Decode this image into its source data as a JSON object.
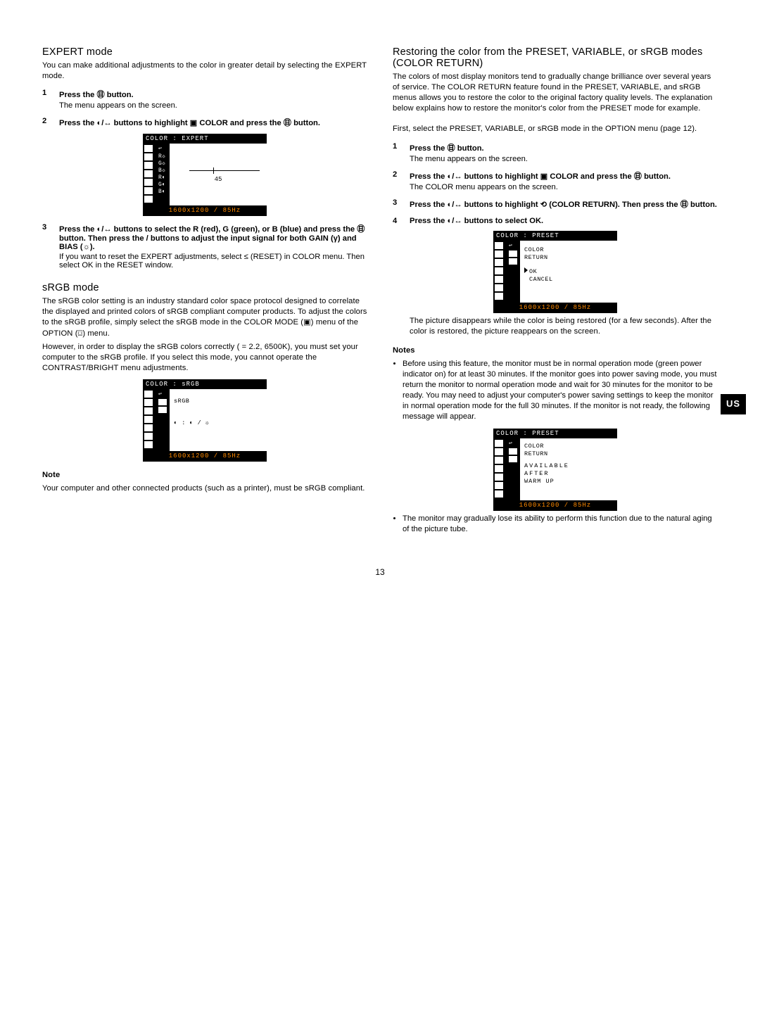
{
  "page_number": "13",
  "side_tab": "US",
  "left": {
    "expert": {
      "title": "EXPERT mode",
      "intro": "You can make additional adjustments to the color in greater detail by selecting the EXPERT mode.",
      "steps": [
        {
          "n": "1",
          "bold": "Press the ㊐ button.",
          "sub": "The menu appears on the screen."
        },
        {
          "n": "2",
          "bold": "Press the ◐/↔ buttons to highlight ▣ COLOR and press the ㊐ button.",
          "sub": ""
        },
        {
          "n": "3",
          "bold": "Press the ◐/↔ buttons to select the R (red), G (green), or B (blue) and press the ㊐ button. Then press the   /   buttons to adjust the input signal for both GAIN (γ) and BIAS (☼).",
          "sub": "If you want to reset the EXPERT adjustments, select ≤  (RESET) in COLOR menu. Then select OK in the RESET window."
        }
      ],
      "osd": {
        "title": "COLOR   : EXPERT",
        "labels": "R☼\nG☼\nB☼\nR◐\nG◐\nB◐",
        "slider_value": "45",
        "footer": "1600x1200 / 85Hz"
      }
    },
    "srgb": {
      "title": "sRGB mode",
      "p1": "The sRGB color setting is an industry standard color space protocol designed to correlate the displayed and printed colors of sRGB compliant computer products. To adjust the colors to the sRGB profile, simply select the sRGB mode in the COLOR MODE (▣) menu of the OPTION (⌼) menu.",
      "p2": "However, in order to display the sRGB colors correctly (  = 2.2, 6500K), you must set your computer to the sRGB profile. If you select this mode, you cannot operate the CONTRAST/BRIGHT menu adjustments.",
      "osd": {
        "title": "COLOR   : sRGB",
        "text_line": "sRGB",
        "bottom_row": "◐ : ◐ / ☼",
        "footer": "1600x1200 / 85Hz"
      },
      "note_head": "Note",
      "note_body": "Your computer and other connected products (such as a printer), must be sRGB compliant."
    }
  },
  "right": {
    "restore": {
      "title": "Restoring the color from the PRESET, VARIABLE, or sRGB modes (COLOR RETURN)",
      "intro": "The colors of most display monitors tend to gradually change brilliance over several years of service. The COLOR RETURN feature found in the PRESET, VARIABLE, and sRGB menus allows you to restore the color to the original factory quality levels. The explanation below explains how to restore the monitor's color from the PRESET mode for example.",
      "pre_step": "First, select the PRESET, VARIABLE, or sRGB mode in the OPTION menu (page 12).",
      "steps": [
        {
          "n": "1",
          "bold": "Press the ㊐ button.",
          "sub": "The menu appears on the screen."
        },
        {
          "n": "2",
          "bold": "Press the ◐/↔ buttons to highlight ▣ COLOR and press the ㊐ button.",
          "sub": "The COLOR menu appears on the screen."
        },
        {
          "n": "3",
          "bold": " Press the ◐/↔ buttons to highlight ⟲ (COLOR RETURN). Then press the ㊐ button.",
          "sub": ""
        },
        {
          "n": "4",
          "bold": "Press the ◐/↔ buttons to select OK.",
          "sub": ""
        }
      ],
      "osd1": {
        "title": "COLOR   : PRESET",
        "line1": "COLOR",
        "line2": "RETURN",
        "opt1": "OK",
        "opt2": "CANCEL",
        "footer": "1600x1200 / 85Hz"
      },
      "below_osd1": "The picture disappears while the color is being restored (for a few seconds). After the color is restored, the picture reappears on the screen.",
      "notes_head": "Notes",
      "notes": [
        "Before using this feature, the monitor must be in normal operation mode (green power indicator on) for at least 30 minutes. If the monitor goes into power saving mode, you must return the monitor to normal operation mode and wait for 30 minutes for the monitor to be ready. You may need to adjust your computer's power saving settings to keep the monitor in normal operation mode for the full 30 minutes. If the monitor is not ready, the following message will appear.",
        "The monitor may gradually lose its ability to perform this function due to the natural aging of the picture tube."
      ],
      "osd2": {
        "title": "COLOR   : PRESET",
        "line1": "COLOR",
        "line2": "RETURN",
        "line3": "AVAILABLE",
        "line4": "AFTER",
        "line5": "WARM UP",
        "footer": "1600x1200 / 85Hz"
      }
    }
  }
}
